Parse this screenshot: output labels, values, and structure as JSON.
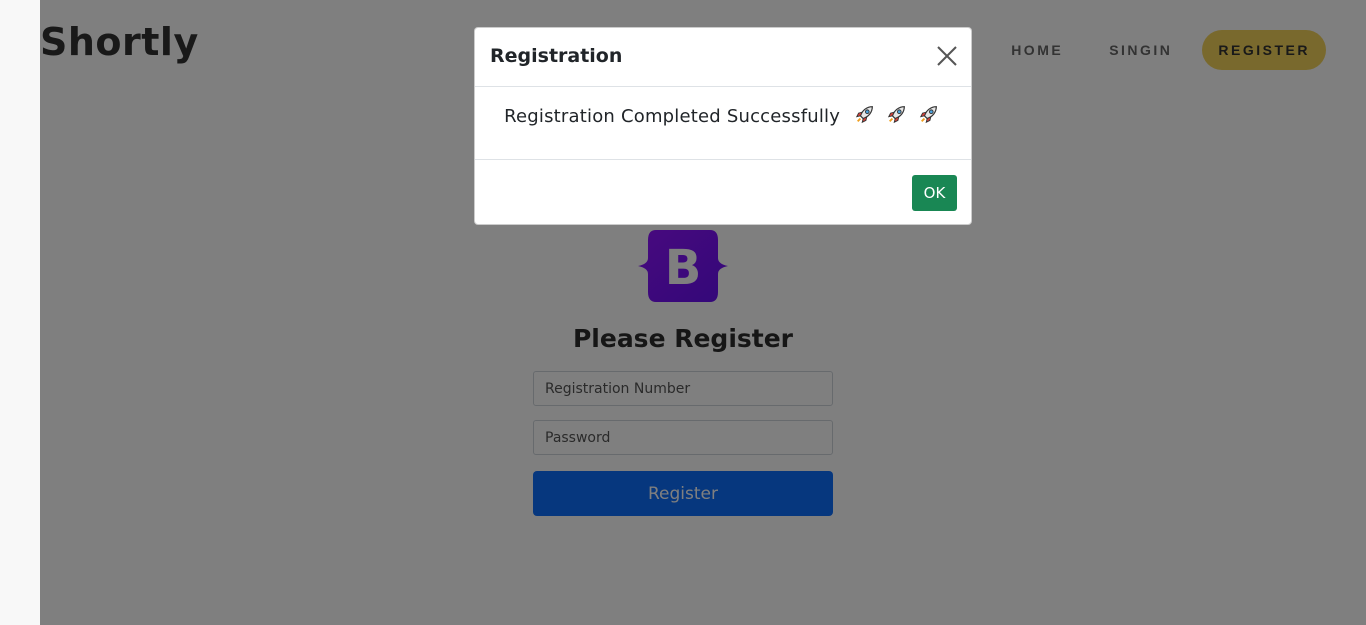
{
  "navbar": {
    "brand": "Shortly",
    "links": [
      {
        "label": "HOME"
      },
      {
        "label": "SINGIN"
      },
      {
        "label": "REGISTER"
      }
    ]
  },
  "form": {
    "logo_letter": "B",
    "heading": "Please Register",
    "registration_placeholder": "Registration Number",
    "registration_value": "",
    "password_placeholder": "Password",
    "password_value": "",
    "submit_label": "Register"
  },
  "modal": {
    "title": "Registration",
    "message": "Registration Completed Successfully",
    "ok_label": "OK"
  },
  "colors": {
    "nav_active": "#f2d25a",
    "bootstrap_purple": "#7952b3",
    "primary": "#0d6efd",
    "success": "#198754"
  },
  "icons": {
    "close": "close-icon",
    "rocket": "rocket-icon",
    "logo": "bootstrap-logo-icon"
  }
}
